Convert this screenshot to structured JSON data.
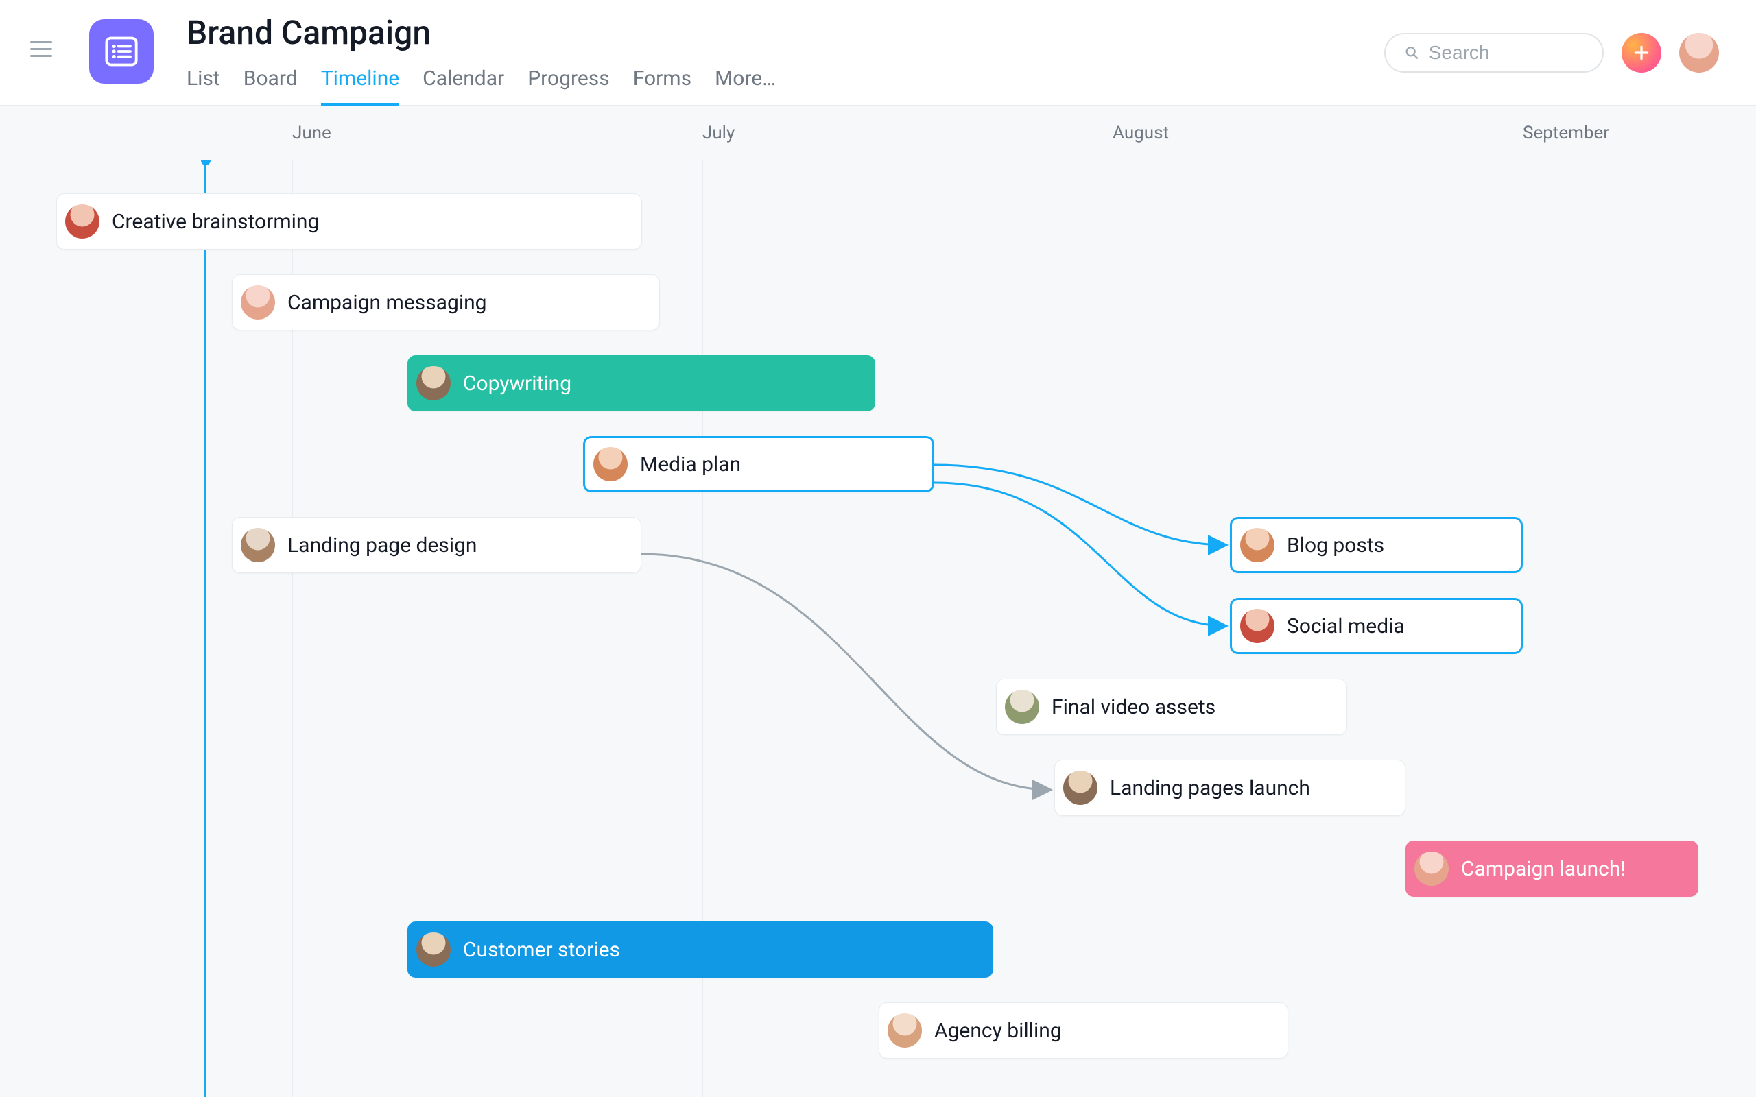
{
  "project": {
    "title": "Brand Campaign"
  },
  "tabs": {
    "list": "List",
    "board": "Board",
    "timeline": "Timeline",
    "calendar": "Calendar",
    "progress": "Progress",
    "forms": "Forms",
    "more": "More…"
  },
  "active_tab": "Timeline",
  "search": {
    "placeholder": "Search"
  },
  "months": {
    "june": "June",
    "july": "July",
    "august": "August",
    "september": "September"
  },
  "tasks": {
    "creative_brainstorming": "Creative brainstorming",
    "campaign_messaging": "Campaign messaging",
    "copywriting": "Copywriting",
    "media_plan": "Media plan",
    "landing_page_design": "Landing page design",
    "blog_posts": "Blog posts",
    "social_media": "Social media",
    "final_video_assets": "Final video assets",
    "landing_pages_launch": "Landing pages launch",
    "campaign_launch": "Campaign launch!",
    "customer_stories": "Customer stories",
    "agency_billing": "Agency billing"
  },
  "colors": {
    "accent_blue": "#14aaf5",
    "accent_green": "#25c0a3",
    "accent_pink": "#f5779b",
    "brand_purple": "#796eff"
  }
}
